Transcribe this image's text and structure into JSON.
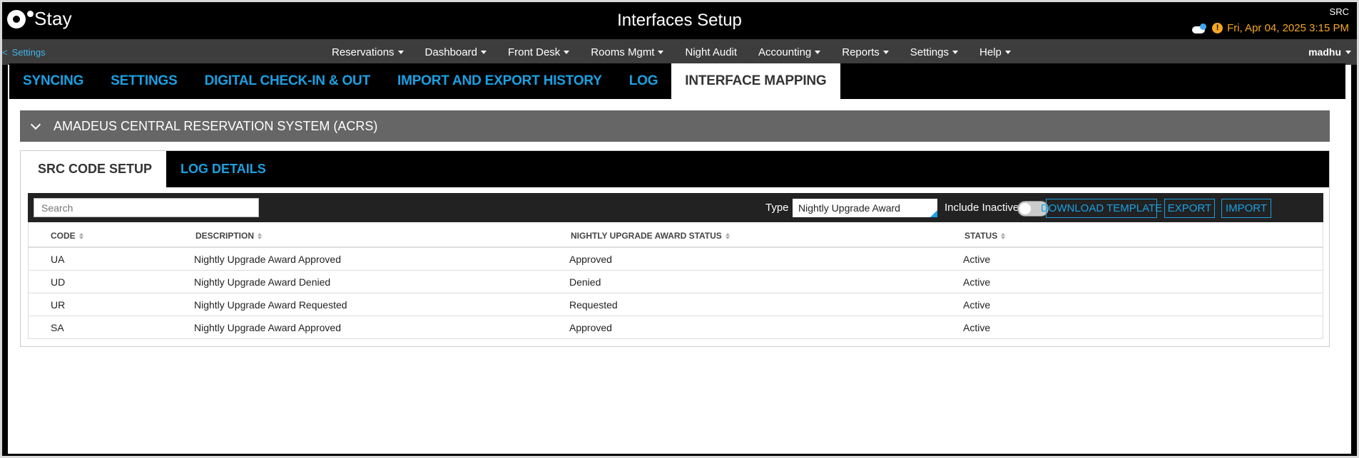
{
  "header": {
    "logo_text": "Stay",
    "title": "Interfaces Setup",
    "property_code": "SRC",
    "datetime": "Fri, Apr 04, 2025 3:15 PM",
    "alert_glyph": "!"
  },
  "nav": {
    "back_arrow": "<",
    "back_label": "Settings",
    "items": [
      {
        "label": "Reservations",
        "has_caret": true
      },
      {
        "label": "Dashboard",
        "has_caret": true
      },
      {
        "label": "Front Desk",
        "has_caret": true
      },
      {
        "label": "Rooms Mgmt",
        "has_caret": true
      },
      {
        "label": "Night Audit",
        "has_caret": false
      },
      {
        "label": "Accounting",
        "has_caret": true
      },
      {
        "label": "Reports",
        "has_caret": true
      },
      {
        "label": "Settings",
        "has_caret": true
      },
      {
        "label": "Help",
        "has_caret": true
      }
    ],
    "user": "madhu"
  },
  "tabs": [
    {
      "label": "SYNCING"
    },
    {
      "label": "SETTINGS"
    },
    {
      "label": "DIGITAL CHECK-IN & OUT"
    },
    {
      "label": "IMPORT AND EXPORT HISTORY"
    },
    {
      "label": "LOG"
    },
    {
      "label": "INTERFACE MAPPING"
    }
  ],
  "active_tab": "INTERFACE MAPPING",
  "accordion": {
    "title": "AMADEUS CENTRAL RESERVATION SYSTEM (ACRS)",
    "expanded": true
  },
  "subtabs": [
    {
      "label": "SRC CODE SETUP"
    },
    {
      "label": "LOG DETAILS"
    }
  ],
  "active_subtab": "SRC CODE SETUP",
  "toolbar": {
    "search_placeholder": "Search",
    "type_label": "Type",
    "type_value": "Nightly Upgrade Award",
    "include_inactive_label": "Include Inactive",
    "include_inactive_on": false,
    "download_template": "DOWNLOAD TEMPLATE",
    "export": "EXPORT",
    "import": "IMPORT"
  },
  "table": {
    "columns": [
      "CODE",
      "DESCRIPTION",
      "NIGHTLY UPGRADE AWARD STATUS",
      "STATUS"
    ],
    "rows": [
      [
        "UA",
        "Nightly Upgrade Award Approved",
        "Approved",
        "Active"
      ],
      [
        "UD",
        "Nightly Upgrade Award Denied",
        "Denied",
        "Active"
      ],
      [
        "UR",
        "Nightly Upgrade Award Requested",
        "Requested",
        "Active"
      ],
      [
        "SA",
        "Nightly Upgrade Award Approved",
        "Approved",
        "Active"
      ]
    ]
  },
  "colors": {
    "accent": "#1ba0e2",
    "warning": "#f5a623",
    "nav_bg": "#3d3d3d",
    "accordion_bg": "#666666"
  }
}
